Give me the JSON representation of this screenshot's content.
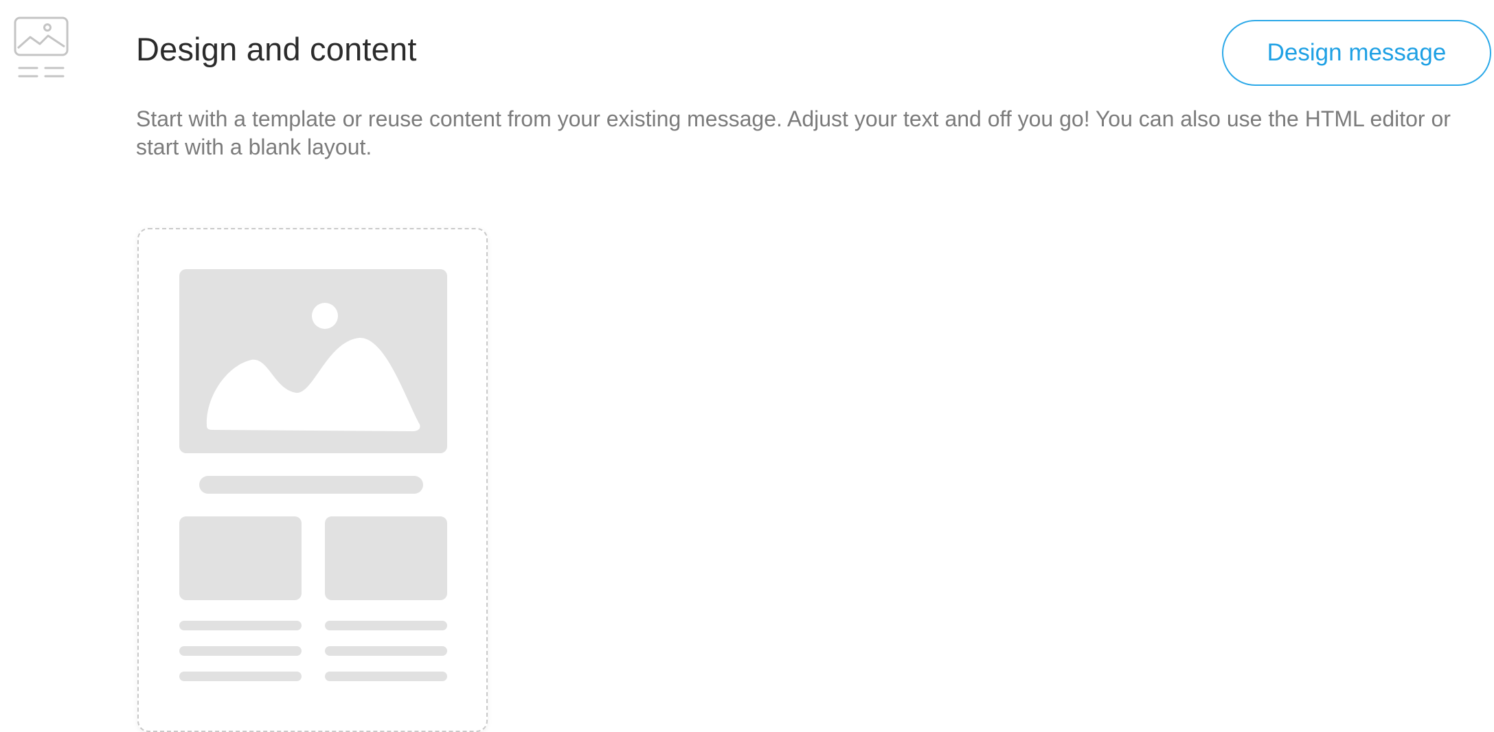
{
  "section": {
    "icon": "design-content-icon",
    "title": "Design and content",
    "description": "Start with a template or reuse content from your existing message. Adjust your text and off you go! You can also use the HTML editor or start with a blank layout."
  },
  "actions": {
    "design_message_label": "Design message"
  },
  "layout_preview": {
    "icon": "image-placeholder-icon"
  },
  "colors": {
    "accent": "#1ea0e4",
    "title": "#2b2b2b",
    "description": "#7b7b7b",
    "placeholder": "#e1e1e1",
    "card_border": "#c9c9c9"
  }
}
